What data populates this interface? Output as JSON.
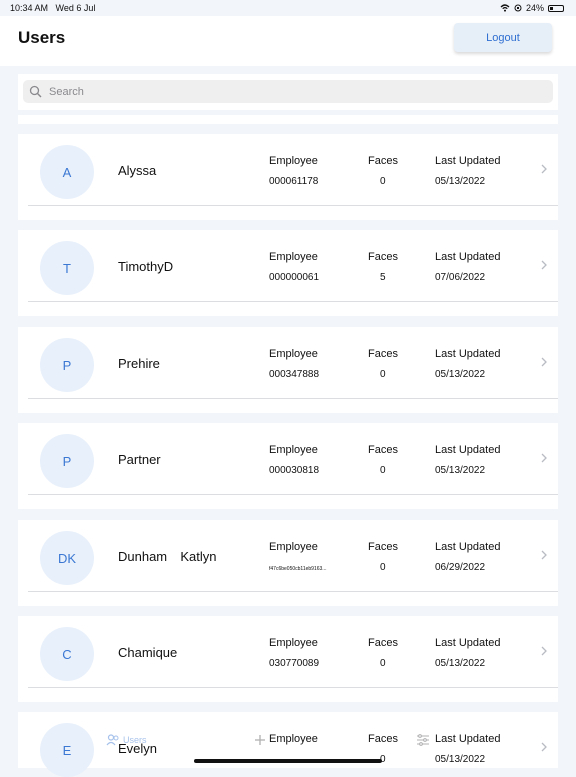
{
  "status_bar": {
    "time": "10:34 AM",
    "date": "Wed 6 Jul",
    "battery": "24%"
  },
  "header": {
    "title": "Users",
    "logout_label": "Logout"
  },
  "search": {
    "placeholder": "Search"
  },
  "columns": {
    "employee": "Employee",
    "faces": "Faces",
    "last_updated": "Last Updated"
  },
  "users": [
    {
      "initials": "A",
      "name": "Alyssa",
      "employee_id": "000061178",
      "faces": "0",
      "last_updated": "05/13/2022"
    },
    {
      "initials": "T",
      "name": "TimothyD",
      "employee_id": "000000061",
      "faces": "5",
      "last_updated": "07/06/2022"
    },
    {
      "initials": "P",
      "name": "Prehire",
      "employee_id": "000347888",
      "faces": "0",
      "last_updated": "05/13/2022"
    },
    {
      "initials": "P",
      "name": "Partner",
      "employee_id": "000030818",
      "faces": "0",
      "last_updated": "05/13/2022"
    },
    {
      "initials": "DK",
      "name": "Dunham  Katlyn",
      "employee_id": "f47c6be050cb11eb9163...",
      "faces": "0",
      "last_updated": "06/29/2022"
    },
    {
      "initials": "C",
      "name": "Chamique",
      "employee_id": "030770089",
      "faces": "0",
      "last_updated": "05/13/2022"
    },
    {
      "initials": "E",
      "name": "Evelyn",
      "employee_id": "",
      "faces": "0",
      "last_updated": "05/13/2022"
    }
  ],
  "tabbar": {
    "users_label": "Users"
  },
  "colors": {
    "accent": "#3b78d3",
    "avatar_bg": "#e8f0fb",
    "background": "#f2f5fa"
  },
  "icons": {
    "search": "search-icon",
    "chevron": "chevron-right-icon",
    "add": "plus-icon",
    "filter": "sliders-icon",
    "users": "users-icon"
  }
}
